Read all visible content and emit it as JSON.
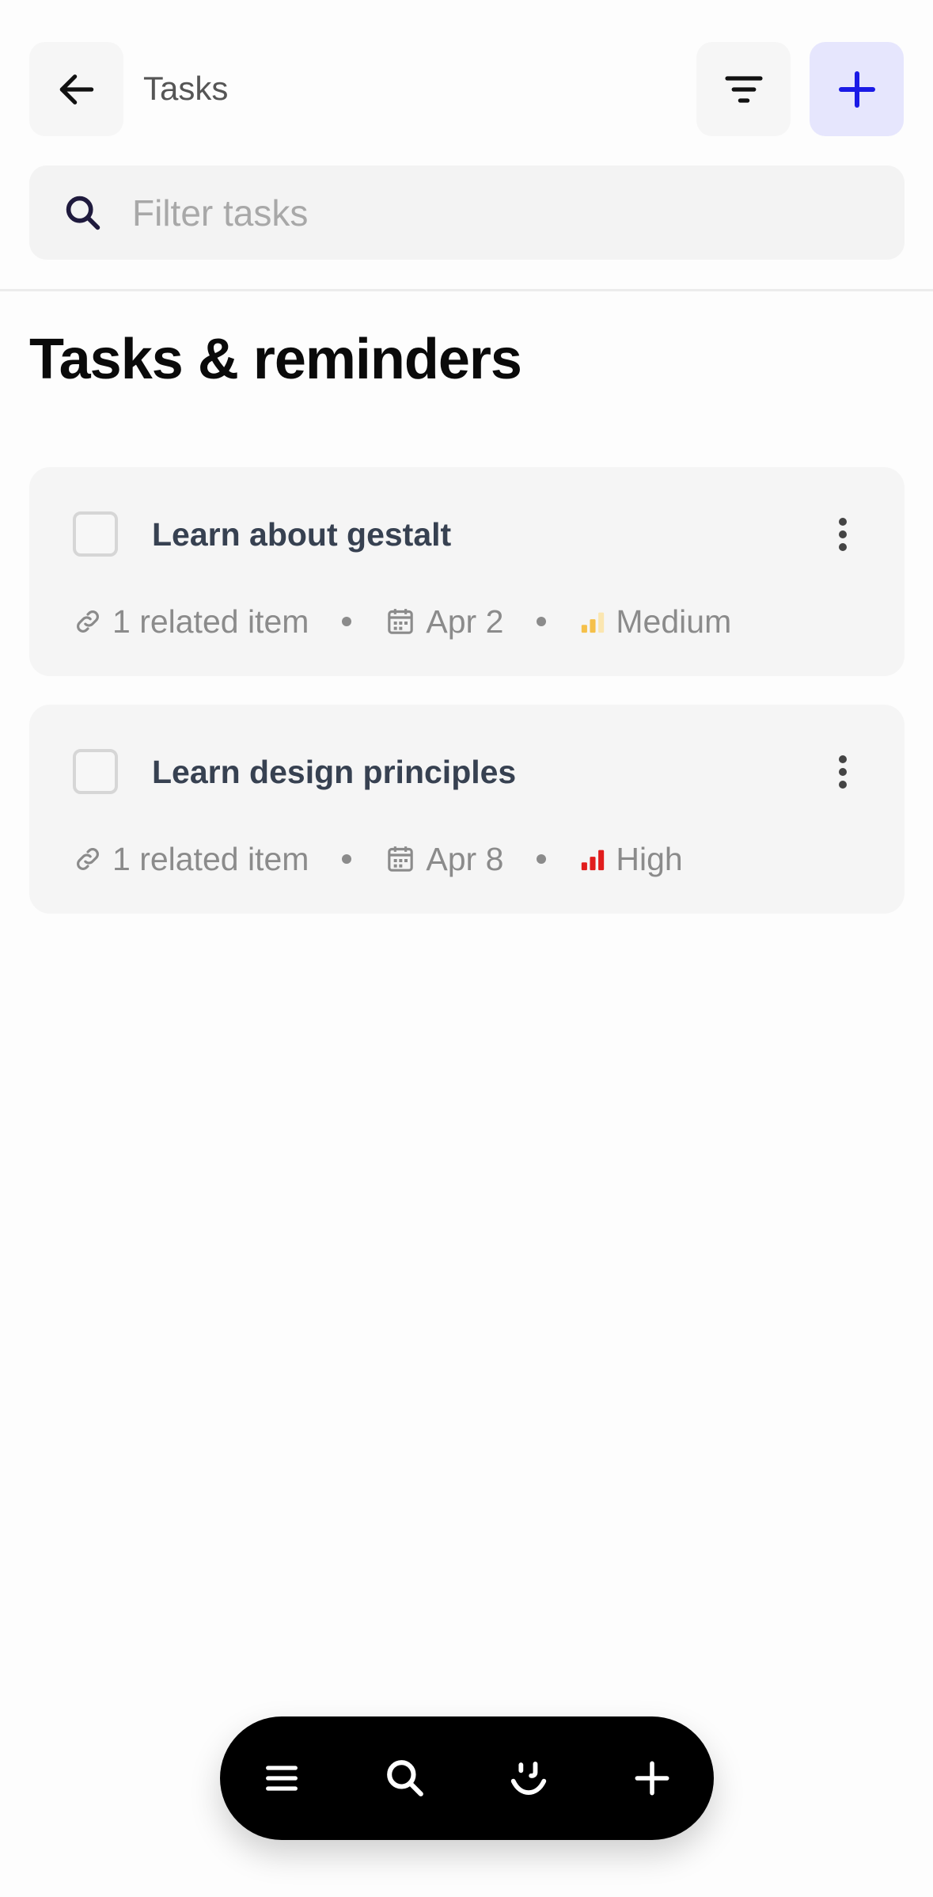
{
  "header": {
    "title": "Tasks",
    "search_placeholder": "Filter tasks"
  },
  "page_title": "Tasks & reminders",
  "tasks": [
    {
      "title": "Learn about gestalt",
      "related": "1 related item",
      "due": "Apr 2",
      "priority": "Medium",
      "priority_color": "#f5c04a",
      "priority_bars_active": 2
    },
    {
      "title": "Learn design principles",
      "related": "1 related item",
      "due": "Apr 8",
      "priority": "High",
      "priority_color": "#e11d1d",
      "priority_bars_active": 3
    }
  ],
  "colors": {
    "accent": "#1a1ae6",
    "accent_bg": "#e6e6fd",
    "card_bg": "#f5f5f5",
    "task_title": "#374151",
    "meta_text": "#8b8b8b"
  },
  "icons": {
    "back": "arrow-left-icon",
    "filter": "filter-icon",
    "add": "plus-icon",
    "search": "search-icon",
    "link": "link-icon",
    "calendar": "calendar-icon",
    "priority": "signal-bars-icon",
    "more": "more-vertical-icon",
    "nav": [
      "menu-icon",
      "search-icon",
      "assistant-face-icon",
      "plus-icon"
    ]
  }
}
